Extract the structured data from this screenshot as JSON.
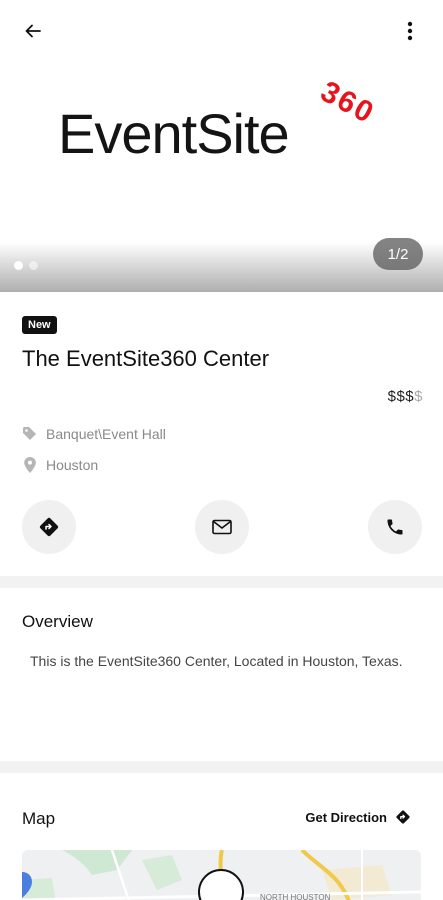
{
  "header": {
    "back_icon": "arrow-left-icon",
    "more_icon": "more-vertical-icon"
  },
  "gallery": {
    "logo_text": "EventSite",
    "logo_number": "360",
    "logo_number_color": "#e8141c",
    "pager": "1/2",
    "current_index": 1,
    "total_images": 2
  },
  "listing": {
    "badge": "New",
    "name": "The EventSite360 Center",
    "price_active": "$$$",
    "price_inactive": "$",
    "category_icon": "tag-icon",
    "category": "Banquet\\Event Hall",
    "location_icon": "map-pin-icon",
    "location": "Houston"
  },
  "actions": {
    "directions_icon": "directions-icon",
    "email_icon": "mail-icon",
    "call_icon": "phone-icon"
  },
  "overview": {
    "title": "Overview",
    "text": "This is the EventSite360 Center, Located in Houston, Texas."
  },
  "map_section": {
    "title": "Map",
    "get_direction": "Get Direction",
    "map_label": "NORTH HOUSTON"
  },
  "colors": {
    "accent": "#111111",
    "background": "#f2f2f2",
    "card": "#ffffff",
    "muted": "#8a8a8a"
  }
}
